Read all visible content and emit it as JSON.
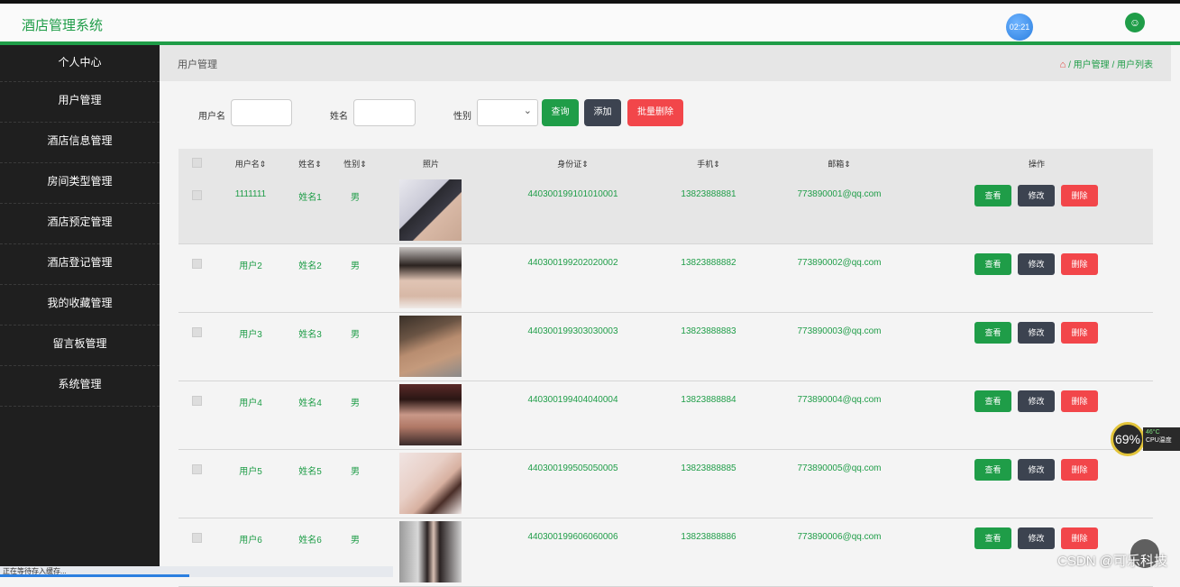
{
  "app": {
    "title": "酒店管理系统",
    "clock": "02:21"
  },
  "sidebar": {
    "items": [
      {
        "label": "个人中心"
      },
      {
        "label": "用户管理"
      },
      {
        "label": "酒店信息管理"
      },
      {
        "label": "房间类型管理"
      },
      {
        "label": "酒店预定管理"
      },
      {
        "label": "酒店登记管理"
      },
      {
        "label": "我的收藏管理"
      },
      {
        "label": "留言板管理"
      },
      {
        "label": "系统管理"
      }
    ]
  },
  "breadcrumb": {
    "page_title": "用户管理",
    "sep": "/",
    "level1": "用户管理",
    "level2": "用户列表"
  },
  "search": {
    "username_label": "用户名",
    "name_label": "姓名",
    "gender_label": "性别",
    "query_button": "查询",
    "add_button": "添加",
    "batch_delete_button": "批量删除"
  },
  "table": {
    "headers": {
      "username": "用户名⇕",
      "name": "姓名⇕",
      "gender": "性别⇕",
      "photo": "照片",
      "idcard": "身份证⇕",
      "phone": "手机⇕",
      "email": "邮箱⇕",
      "actions": "操作"
    },
    "action_labels": {
      "view": "查看",
      "edit": "修改",
      "delete": "删除"
    },
    "rows": [
      {
        "username": "1111111",
        "name": "姓名1",
        "gender": "男",
        "idcard": "440300199101010001",
        "phone": "13823888881",
        "email": "773890001@qq.com"
      },
      {
        "username": "用户2",
        "name": "姓名2",
        "gender": "男",
        "idcard": "440300199202020002",
        "phone": "13823888882",
        "email": "773890002@qq.com"
      },
      {
        "username": "用户3",
        "name": "姓名3",
        "gender": "男",
        "idcard": "440300199303030003",
        "phone": "13823888883",
        "email": "773890003@qq.com"
      },
      {
        "username": "用户4",
        "name": "姓名4",
        "gender": "男",
        "idcard": "440300199404040004",
        "phone": "13823888884",
        "email": "773890004@qq.com"
      },
      {
        "username": "用户5",
        "name": "姓名5",
        "gender": "男",
        "idcard": "440300199505050005",
        "phone": "13823888885",
        "email": "773890005@qq.com"
      },
      {
        "username": "用户6",
        "name": "姓名6",
        "gender": "男",
        "idcard": "440300199606060006",
        "phone": "13823888886",
        "email": "773890006@qq.com"
      }
    ]
  },
  "overlay": {
    "cpu_percent": "69%",
    "cpu_temp": "46°C",
    "cpu_label": "CPU温度",
    "status_text": "正在等待存入缓存...",
    "watermark": "CSDN @可乐科技"
  },
  "colors": {
    "accent": "#1f9d48",
    "sidebar_bg": "#1f1f1f",
    "danger": "#f2464a",
    "dark_button": "#3c4350"
  }
}
